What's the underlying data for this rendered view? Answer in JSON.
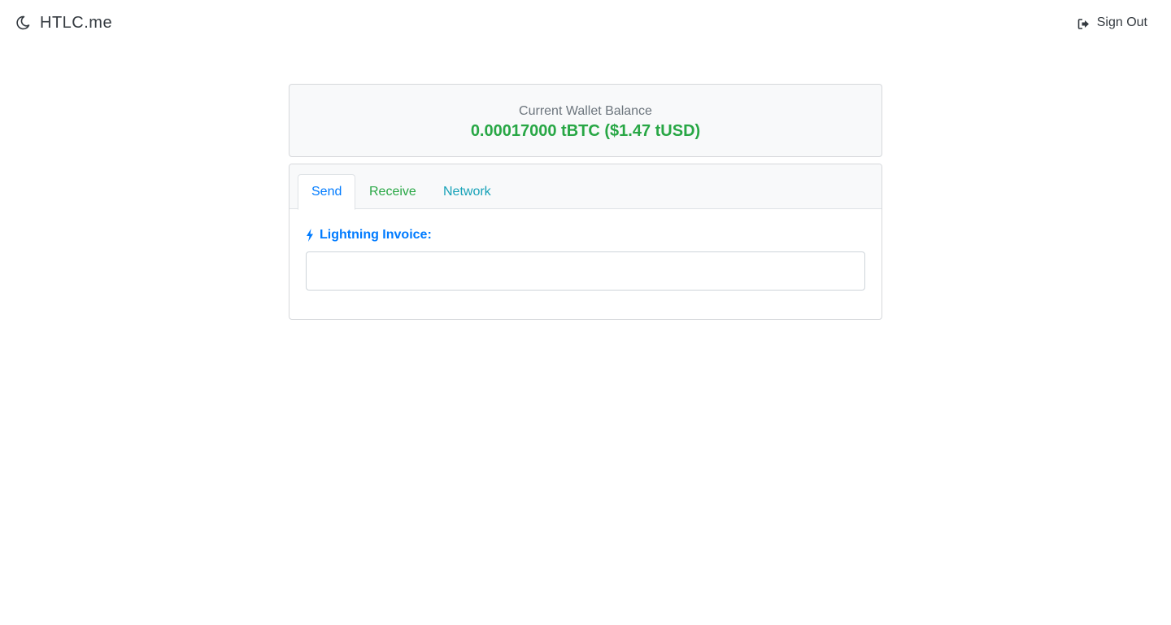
{
  "navbar": {
    "brand_icon": "moon-icon",
    "brand_text": "HTLC.me",
    "signout_icon": "sign-out-icon",
    "signout_label": "Sign Out"
  },
  "balance": {
    "label": "Current Wallet Balance",
    "value": "0.00017000 tBTC ($1.47 tUSD)",
    "value_color": "#28a745"
  },
  "tabs": {
    "items": [
      {
        "label": "Send",
        "active": true,
        "color": "#007bff"
      },
      {
        "label": "Receive",
        "active": false,
        "color": "#28a745"
      },
      {
        "label": "Network",
        "active": false,
        "color": "#17a2b8"
      }
    ]
  },
  "send": {
    "invoice_icon": "lightning-icon",
    "invoice_label": "Lightning Invoice:",
    "invoice_value": "",
    "invoice_placeholder": ""
  }
}
